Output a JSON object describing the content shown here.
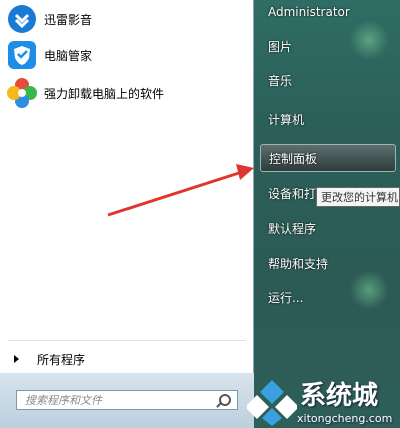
{
  "programs": [
    {
      "label": "迅雷影音",
      "icon": "xunlei-icon"
    },
    {
      "label": "电脑管家",
      "icon": "shield-icon"
    },
    {
      "label": "强力卸载电脑上的软件",
      "icon": "flower-icon"
    }
  ],
  "all_programs_label": "所有程序",
  "search": {
    "placeholder": "搜索程序和文件"
  },
  "right_menu": {
    "user": "Administrator",
    "pictures": "图片",
    "music": "音乐",
    "computer": "计算机",
    "control_panel": "控制面板",
    "devices": "设备和打",
    "default_programs": "默认程序",
    "help": "帮助和支持",
    "run": "运行..."
  },
  "tooltip": "更改您的计算机",
  "watermark": {
    "brand": "系统城",
    "url": "xitongcheng.com"
  },
  "colors": {
    "arrow": "#e0342e",
    "highlight": "#3c4a4a"
  }
}
